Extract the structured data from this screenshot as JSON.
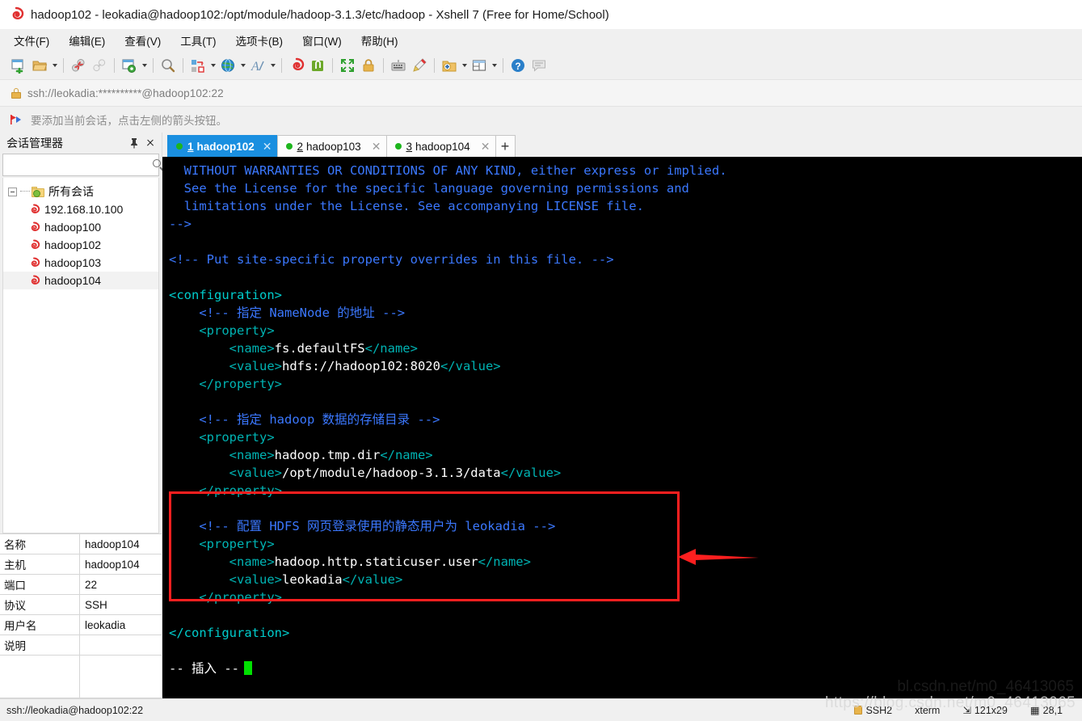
{
  "window": {
    "title": "hadoop102 - leokadia@hadoop102:/opt/module/hadoop-3.1.3/etc/hadoop - Xshell 7 (Free for Home/School)",
    "icon": "xshell-logo-icon"
  },
  "menubar": {
    "items": [
      {
        "label": "文件(F)",
        "name": "menu-file"
      },
      {
        "label": "编辑(E)",
        "name": "menu-edit"
      },
      {
        "label": "查看(V)",
        "name": "menu-view"
      },
      {
        "label": "工具(T)",
        "name": "menu-tools"
      },
      {
        "label": "选项卡(B)",
        "name": "menu-tabs"
      },
      {
        "label": "窗口(W)",
        "name": "menu-window"
      },
      {
        "label": "帮助(H)",
        "name": "menu-help"
      }
    ]
  },
  "toolbar": {
    "icons": [
      "new-session-icon",
      "open-folder-icon",
      "disconnect-icon",
      "link-icon",
      "session-properties-icon",
      "find-icon",
      "transfer-file-icon",
      "globe-icon",
      "font-icon",
      "xshell-icon",
      "xftp-icon",
      "fullscreen-icon",
      "lock-icon",
      "keyboard-icon",
      "highlight-icon",
      "add-folder-icon",
      "layout-icon",
      "help-icon",
      "feedback-icon"
    ]
  },
  "address": {
    "value": "ssh://leokadia:**********@hadoop102:22",
    "lock_icon": "lock-icon"
  },
  "notification": {
    "text": "要添加当前会话，点击左侧的箭头按钮。",
    "icon": "red-flag-arrow-icon"
  },
  "sidebar": {
    "title": "会话管理器",
    "pin_icon": "pin-icon",
    "close_icon": "close-icon",
    "search": {
      "value": "",
      "placeholder": "",
      "icon": "search-icon"
    },
    "tree": {
      "root": {
        "label": "所有会话",
        "icon": "folder-gear-icon",
        "expanded": true
      },
      "children": [
        {
          "label": "192.168.10.100",
          "icon": "xshell-session-icon"
        },
        {
          "label": "hadoop100",
          "icon": "xshell-session-icon"
        },
        {
          "label": "hadoop102",
          "icon": "xshell-session-icon"
        },
        {
          "label": "hadoop103",
          "icon": "xshell-session-icon"
        },
        {
          "label": "hadoop104",
          "icon": "xshell-session-icon",
          "selected": true
        }
      ]
    },
    "properties": [
      {
        "key": "名称",
        "value": "hadoop104"
      },
      {
        "key": "主机",
        "value": "hadoop104"
      },
      {
        "key": "端口",
        "value": "22"
      },
      {
        "key": "协议",
        "value": "SSH"
      },
      {
        "key": "用户名",
        "value": "leokadia"
      },
      {
        "key": "说明",
        "value": ""
      }
    ]
  },
  "tabs": {
    "items": [
      {
        "num": "1",
        "label": "hadoop102",
        "active": true,
        "status": "connected"
      },
      {
        "num": "2",
        "label": "hadoop103",
        "active": false,
        "status": "connected"
      },
      {
        "num": "3",
        "label": "hadoop104",
        "active": false,
        "status": "connected"
      }
    ],
    "add_label": "+"
  },
  "terminal": {
    "lines": [
      [
        {
          "t": "  WITHOUT WARRANTIES OR CONDITIONS OF ANY KIND, either express or implied.",
          "c": "comment"
        }
      ],
      [
        {
          "t": "  See the License for the specific language governing permissions and",
          "c": "comment"
        }
      ],
      [
        {
          "t": "  limitations under the License. See accompanying LICENSE file.",
          "c": "comment"
        }
      ],
      [
        {
          "t": "-->",
          "c": "comment"
        }
      ],
      [
        {
          "t": "",
          "c": "comment"
        }
      ],
      [
        {
          "t": "<!-- Put site-specific property overrides in this file. -->",
          "c": "comment"
        }
      ],
      [
        {
          "t": "",
          "c": "comment"
        }
      ],
      [
        {
          "t": "<configuration>",
          "c": "green"
        }
      ],
      [
        {
          "t": "    <!-- 指定 NameNode 的地址 -->",
          "c": "comment"
        }
      ],
      [
        {
          "t": "    <property>",
          "c": "tag"
        }
      ],
      [
        {
          "t": "        <name>",
          "c": "tag"
        },
        {
          "t": "fs.defaultFS",
          "c": "text"
        },
        {
          "t": "</name>",
          "c": "tag"
        }
      ],
      [
        {
          "t": "        <value>",
          "c": "tag"
        },
        {
          "t": "hdfs://hadoop102:8020",
          "c": "text"
        },
        {
          "t": "</value>",
          "c": "tag"
        }
      ],
      [
        {
          "t": "    </property>",
          "c": "tag"
        }
      ],
      [
        {
          "t": "",
          "c": "text"
        }
      ],
      [
        {
          "t": "    <!-- 指定 hadoop 数据的存储目录 -->",
          "c": "comment"
        }
      ],
      [
        {
          "t": "    <property>",
          "c": "tag"
        }
      ],
      [
        {
          "t": "        <name>",
          "c": "tag"
        },
        {
          "t": "hadoop.tmp.dir",
          "c": "text"
        },
        {
          "t": "</name>",
          "c": "tag"
        }
      ],
      [
        {
          "t": "        <value>",
          "c": "tag"
        },
        {
          "t": "/opt/module/hadoop-3.1.3/data",
          "c": "text"
        },
        {
          "t": "</value>",
          "c": "tag"
        }
      ],
      [
        {
          "t": "    </property>",
          "c": "tag"
        }
      ],
      [
        {
          "t": "",
          "c": "text"
        }
      ],
      [
        {
          "t": "    <!-- 配置 HDFS 网页登录使用的静态用户为 leokadia -->",
          "c": "comment"
        }
      ],
      [
        {
          "t": "    <property>",
          "c": "tag"
        }
      ],
      [
        {
          "t": "        <name>",
          "c": "tag"
        },
        {
          "t": "hadoop.http.staticuser.user",
          "c": "text"
        },
        {
          "t": "</name>",
          "c": "tag"
        }
      ],
      [
        {
          "t": "        <value>",
          "c": "tag"
        },
        {
          "t": "leokadia",
          "c": "text"
        },
        {
          "t": "</value>",
          "c": "tag"
        }
      ],
      [
        {
          "t": "    </property>",
          "c": "tag"
        }
      ],
      [
        {
          "t": "",
          "c": "text"
        }
      ],
      [
        {
          "t": "</configuration>",
          "c": "green"
        }
      ]
    ],
    "mode_line": "-- 插入 --",
    "cursor_visible": true,
    "watermark": "bl.csdn.net/m0_46413065"
  },
  "annotations": {
    "highlight_box_color": "#ff1f1f",
    "arrow_color": "#ff1f1f"
  },
  "statusbar": {
    "connection": "ssh://leokadia@hadoop102:22",
    "protocol": "SSH2",
    "terminal_type": "xterm",
    "size": "121x29",
    "cursor_pos": "28,1",
    "watermark": "https://blog.csdn.net/m0_46413065"
  }
}
